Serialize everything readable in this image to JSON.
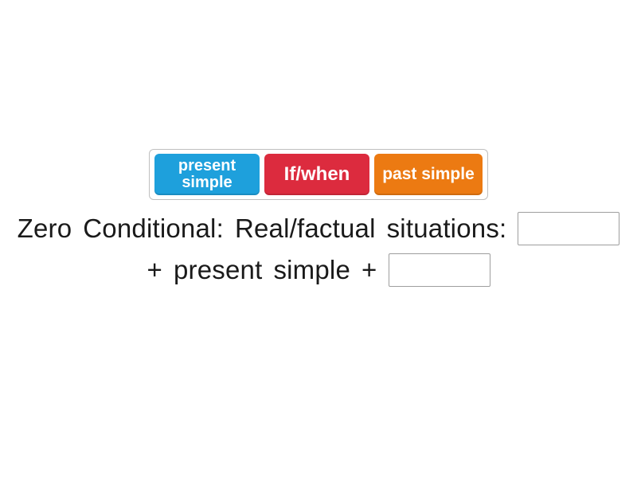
{
  "tiles": [
    {
      "id": "present-simple",
      "label": "present\nsimple",
      "color": "blue"
    },
    {
      "id": "if-when",
      "label": "If/when",
      "color": "red"
    },
    {
      "id": "past-simple",
      "label": "past simple",
      "color": "orange"
    }
  ],
  "sentence": {
    "w0": "Zero",
    "w1": "Conditional:",
    "w2": "Real/factual",
    "w3": "situations:",
    "w4": "+",
    "w5": "present",
    "w6": "simple",
    "w7": "+"
  }
}
